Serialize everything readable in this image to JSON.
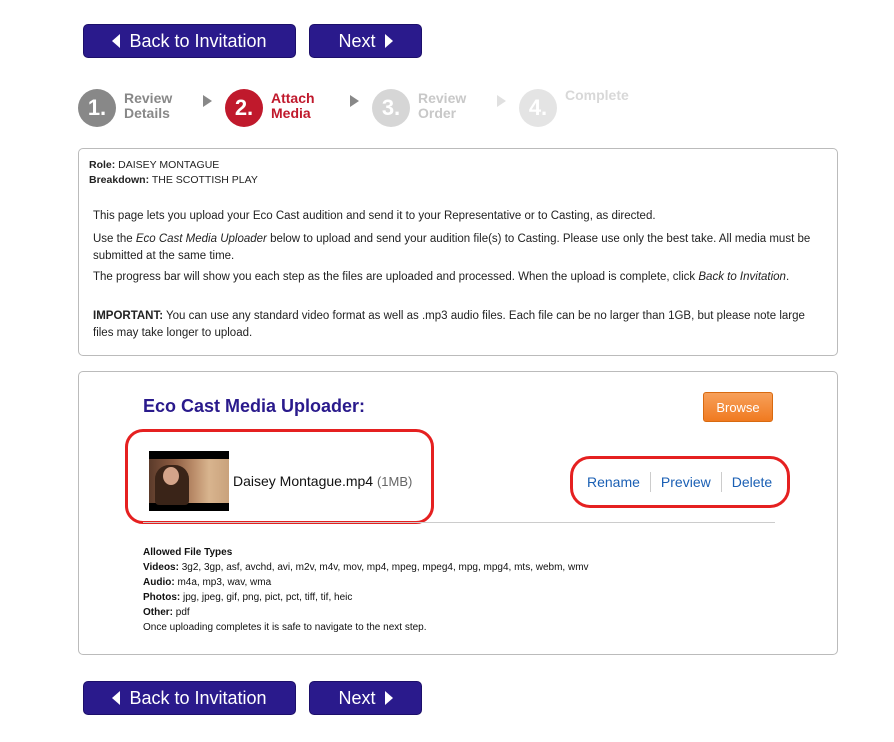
{
  "nav": {
    "back_label": "Back to Invitation",
    "next_label": "Next"
  },
  "steps": [
    {
      "number": "1.",
      "line1": "Review",
      "line2": "Details",
      "state": "done"
    },
    {
      "number": "2.",
      "line1": "Attach",
      "line2": "Media",
      "state": "active"
    },
    {
      "number": "3.",
      "line1": "Review",
      "line2": "Order",
      "state": "pending"
    },
    {
      "number": "4.",
      "line1": "Complete",
      "line2": "",
      "state": "pending"
    }
  ],
  "info": {
    "role_label": "Role:",
    "role_value": "DAISEY MONTAGUE",
    "breakdown_label": "Breakdown:",
    "breakdown_value": "THE SCOTTISH PLAY",
    "p1": "This page lets you upload your Eco Cast audition and send it to your Representative or to Casting, as directed.",
    "p2_a": "Use the ",
    "p2_em": "Eco Cast Media Uploader",
    "p2_b": " below to upload and send your audition file(s) to Casting. Please use only the best take. All media must be submitted at the same time.",
    "p3_a": "The progress bar will show you each step as the files are uploaded and processed. When the upload is complete, click ",
    "p3_em": "Back to Invitation",
    "p3_b": ".",
    "p4_label": "IMPORTANT:",
    "p4_text": " You can use any standard video format as well as .mp3 audio files. Each file can be no larger than 1GB, but please note large files may take longer to upload."
  },
  "uploader": {
    "title": "Eco Cast Media Uploader:",
    "browse_label": "Browse",
    "file": {
      "name": "Daisey Montague.mp4",
      "size": "(1MB)"
    },
    "actions": {
      "rename": "Rename",
      "preview": "Preview",
      "delete": "Delete"
    },
    "allowed": {
      "heading": "Allowed File Types",
      "videos_label": "Videos:",
      "videos": "3g2, 3gp, asf, avchd, avi, m2v, m4v, mov, mp4, mpeg, mpeg4, mpg, mpg4, mts, webm, wmv",
      "audio_label": "Audio:",
      "audio": "m4a, mp3, wav, wma",
      "photos_label": "Photos:",
      "photos": "jpg, jpeg, gif, png, pict, pct, tiff, tif, heic",
      "other_label": "Other:",
      "other": "pdf",
      "note": "Once uploading completes it is safe to navigate to the next step."
    }
  },
  "colors": {
    "primary": "#2a1a8c",
    "active_step": "#c0192c",
    "done_step": "#888888",
    "pending_step": "#d6d6d6",
    "highlight": "#e52020",
    "browse": "#f07a20",
    "link": "#1a5fb4"
  }
}
